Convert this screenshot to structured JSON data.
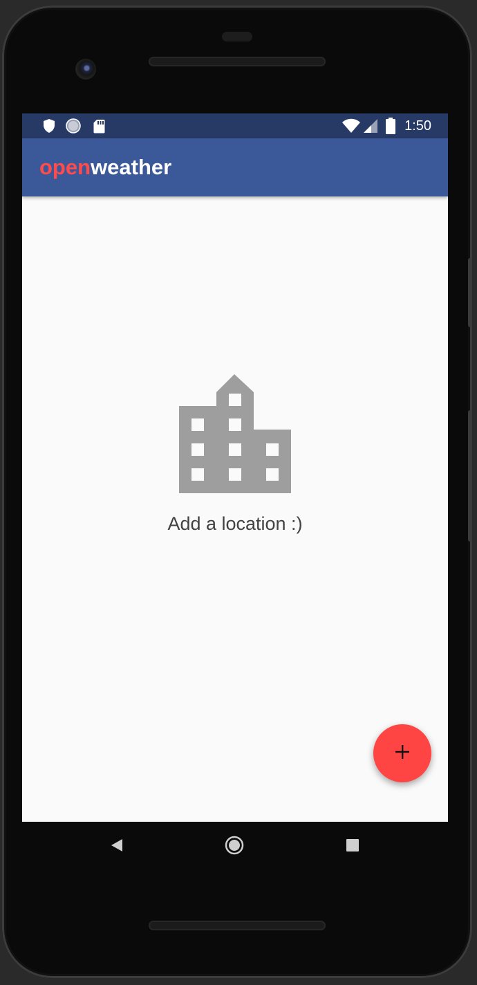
{
  "status_bar": {
    "time": "1:50",
    "left_icons": [
      "shield-icon",
      "sync-circle-icon",
      "sd-card-icon"
    ],
    "right_icons": [
      "wifi-icon",
      "cell-signal-icon",
      "battery-icon"
    ]
  },
  "app_bar": {
    "title_part1": "open",
    "title_part2": "weather",
    "title_part1_color": "#ff4b4b",
    "title_part2_color": "#ffffff",
    "background": "#3b5998"
  },
  "empty_state": {
    "icon": "building-icon",
    "message": "Add a location :)"
  },
  "fab": {
    "icon": "plus-icon",
    "color": "#ff4444"
  },
  "nav_bar": {
    "buttons": [
      "back-icon",
      "home-icon",
      "recents-icon"
    ]
  }
}
